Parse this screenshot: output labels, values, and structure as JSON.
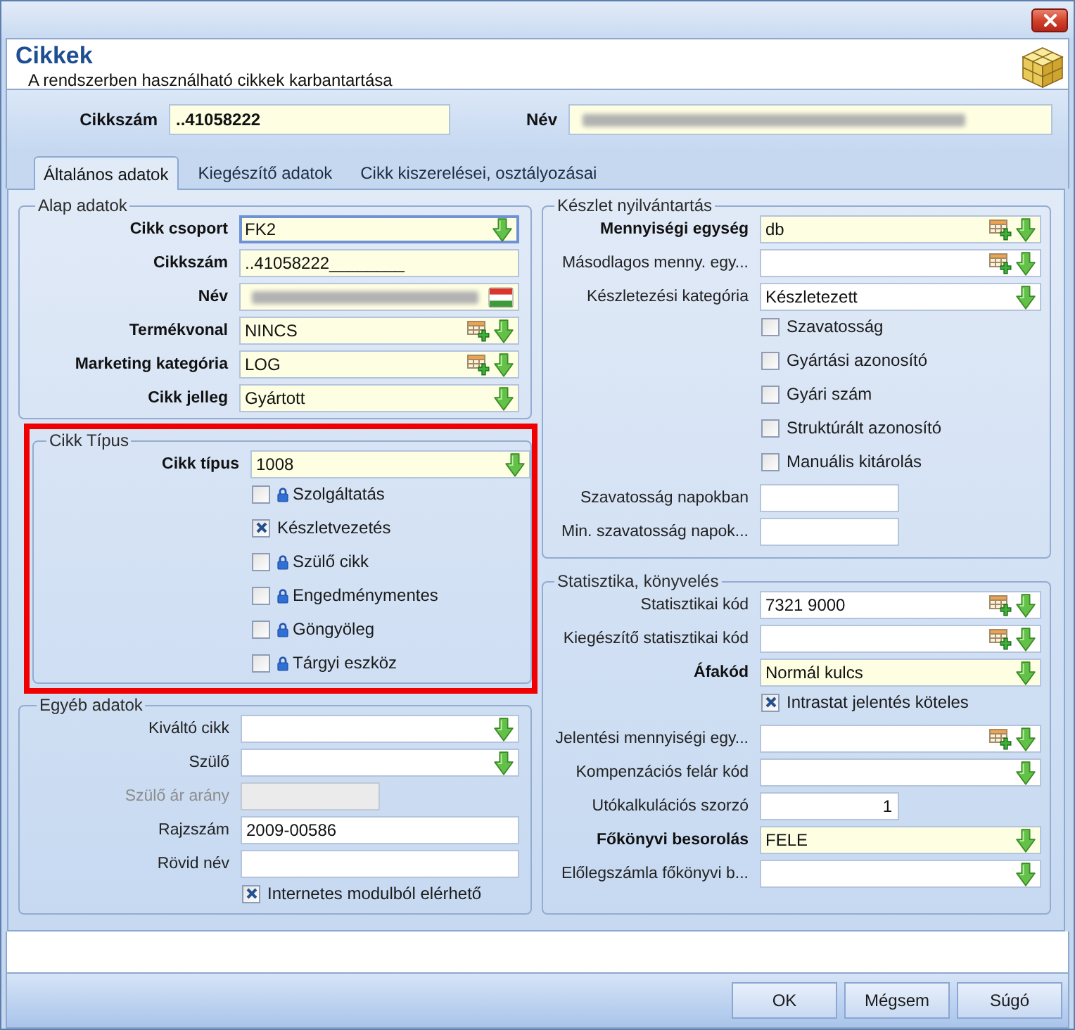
{
  "header": {
    "title": "Cikkek",
    "subtitle": "A rendszerben használható cikkek karbantartása"
  },
  "top_fields": [
    {
      "kind": "text",
      "label": "Cikkszám",
      "value": "..41058222"
    },
    {
      "kind": "blurred",
      "label": "Név"
    }
  ],
  "tabs": [
    {
      "label": "Általános adatok",
      "selected": true
    },
    {
      "label": "Kiegészítő adatok",
      "selected": false
    },
    {
      "label": "Cikk kiszerelései, osztályozásai",
      "selected": false
    }
  ],
  "form": {
    "left": [
      {
        "legend": "Alap adatok",
        "highlighted": false,
        "rows": [
          {
            "kind": "field",
            "label": "Cikk csoport",
            "value": "FK2",
            "required": true,
            "focused": true,
            "disabled": false,
            "lookup": false,
            "dropdown": true
          },
          {
            "kind": "field",
            "label": "Cikkszám",
            "value": "..41058222________",
            "required": true,
            "focused": false,
            "disabled": false,
            "lookup": false,
            "dropdown": false
          },
          {
            "kind": "blurred",
            "label": "Név",
            "required": true,
            "flag": true
          },
          {
            "kind": "field",
            "label": "Termékvonal",
            "value": "NINCS",
            "required": true,
            "focused": false,
            "disabled": false,
            "lookup": true,
            "dropdown": true
          },
          {
            "kind": "field",
            "label": "Marketing kategória",
            "value": "LOG",
            "required": true,
            "focused": false,
            "disabled": false,
            "lookup": true,
            "dropdown": true
          },
          {
            "kind": "field",
            "label": "Cikk jelleg",
            "value": "Gyártott",
            "required": true,
            "focused": false,
            "disabled": false,
            "lookup": false,
            "dropdown": true
          }
        ]
      },
      {
        "legend": "Cikk Típus",
        "highlighted": true,
        "rows": [
          {
            "kind": "field",
            "label": "Cikk típus",
            "value": "1008",
            "required": true,
            "focused": false,
            "disabled": false,
            "lookup": false,
            "dropdown": true
          },
          {
            "kind": "checkbox",
            "label": "Szolgáltatás",
            "checked": false,
            "locked": true
          },
          {
            "kind": "checkbox",
            "label": "Készletvezetés",
            "checked": true,
            "locked": false
          },
          {
            "kind": "checkbox",
            "label": "Szülő cikk",
            "checked": false,
            "locked": true
          },
          {
            "kind": "checkbox",
            "label": "Engedménymentes",
            "checked": false,
            "locked": true
          },
          {
            "kind": "checkbox",
            "label": "Göngyöleg",
            "checked": false,
            "locked": true
          },
          {
            "kind": "checkbox",
            "label": "Tárgyi eszköz",
            "checked": false,
            "locked": true
          }
        ]
      },
      {
        "legend": "Egyéb adatok",
        "highlighted": false,
        "rows": [
          {
            "kind": "field",
            "label": "Kiváltó cikk",
            "required": false,
            "focused": false,
            "disabled": false,
            "lookup": false,
            "dropdown": true
          },
          {
            "kind": "field",
            "label": "Szülő",
            "required": false,
            "focused": false,
            "disabled": false,
            "lookup": false,
            "dropdown": true
          },
          {
            "kind": "number",
            "label": "Szülő ár arány",
            "required": false,
            "focused": false,
            "disabled": true
          },
          {
            "kind": "field",
            "label": "Rajzszám",
            "value": "2009-00586",
            "required": false,
            "focused": false,
            "disabled": false,
            "lookup": false,
            "dropdown": false
          },
          {
            "kind": "field",
            "label": "Rövid név",
            "required": false,
            "focused": false,
            "disabled": false,
            "lookup": false,
            "dropdown": false
          },
          {
            "kind": "checkbox",
            "label": "Internetes modulból elérhető",
            "checked": true,
            "locked": false
          }
        ]
      }
    ],
    "right": [
      {
        "legend": "Készlet nyilvántartás",
        "highlighted": false,
        "rows": [
          {
            "kind": "field",
            "label": "Mennyiségi egység",
            "value": "db",
            "required": true,
            "focused": false,
            "disabled": false,
            "lookup": true,
            "dropdown": true
          },
          {
            "kind": "field",
            "label": "Másodlagos menny. egy...",
            "required": false,
            "focused": false,
            "disabled": false,
            "lookup": true,
            "dropdown": true
          },
          {
            "kind": "field",
            "label": "Készletezési kategória",
            "value": "Készletezett",
            "required": false,
            "focused": false,
            "disabled": false,
            "lookup": false,
            "dropdown": true
          },
          {
            "kind": "checkbox",
            "label": "Szavatosság",
            "checked": false,
            "locked": false
          },
          {
            "kind": "checkbox",
            "label": "Gyártási azonosító",
            "checked": false,
            "locked": false
          },
          {
            "kind": "checkbox",
            "label": "Gyári szám",
            "checked": false,
            "locked": false
          },
          {
            "kind": "checkbox",
            "label": "Struktúrált azonosító",
            "checked": false,
            "locked": false
          },
          {
            "kind": "checkbox",
            "label": "Manuális kitárolás",
            "checked": false,
            "locked": false
          },
          {
            "kind": "number",
            "label": "Szavatosság napokban",
            "required": false,
            "focused": false,
            "disabled": false
          },
          {
            "kind": "number",
            "label": "Min. szavatosság napok...",
            "required": false,
            "focused": false,
            "disabled": false
          }
        ]
      },
      {
        "legend": "Statisztika, könyvelés",
        "highlighted": false,
        "rows": [
          {
            "kind": "field",
            "label": "Statisztikai kód",
            "value": "7321 9000",
            "required": false,
            "focused": false,
            "disabled": false,
            "lookup": true,
            "dropdown": true
          },
          {
            "kind": "field",
            "label": "Kiegészítő statisztikai kód",
            "required": false,
            "focused": false,
            "disabled": false,
            "lookup": true,
            "dropdown": true
          },
          {
            "kind": "field",
            "label": "Áfakód",
            "value": "Normál kulcs",
            "required": true,
            "focused": false,
            "disabled": false,
            "lookup": false,
            "dropdown": true
          },
          {
            "kind": "checkbox",
            "label": "Intrastat jelentés köteles",
            "checked": true,
            "locked": false
          },
          {
            "kind": "field",
            "label": "Jelentési mennyiségi egy...",
            "required": false,
            "focused": false,
            "disabled": false,
            "lookup": true,
            "dropdown": true
          },
          {
            "kind": "field",
            "label": "Kompenzációs felár kód",
            "required": false,
            "focused": false,
            "disabled": false,
            "lookup": false,
            "dropdown": true
          },
          {
            "kind": "number",
            "label": "Utókalkulációs szorzó",
            "value": "1",
            "required": false,
            "focused": false,
            "disabled": false
          },
          {
            "kind": "field",
            "label": "Főkönyvi besorolás",
            "value": "FELE",
            "required": true,
            "focused": false,
            "disabled": false,
            "lookup": false,
            "dropdown": true
          },
          {
            "kind": "field",
            "label": "Előlegszámla főkönyvi b...",
            "required": false,
            "focused": false,
            "disabled": false,
            "lookup": false,
            "dropdown": true
          }
        ]
      }
    ]
  },
  "buttons": [
    "OK",
    "Mégsem",
    "Súgó"
  ]
}
